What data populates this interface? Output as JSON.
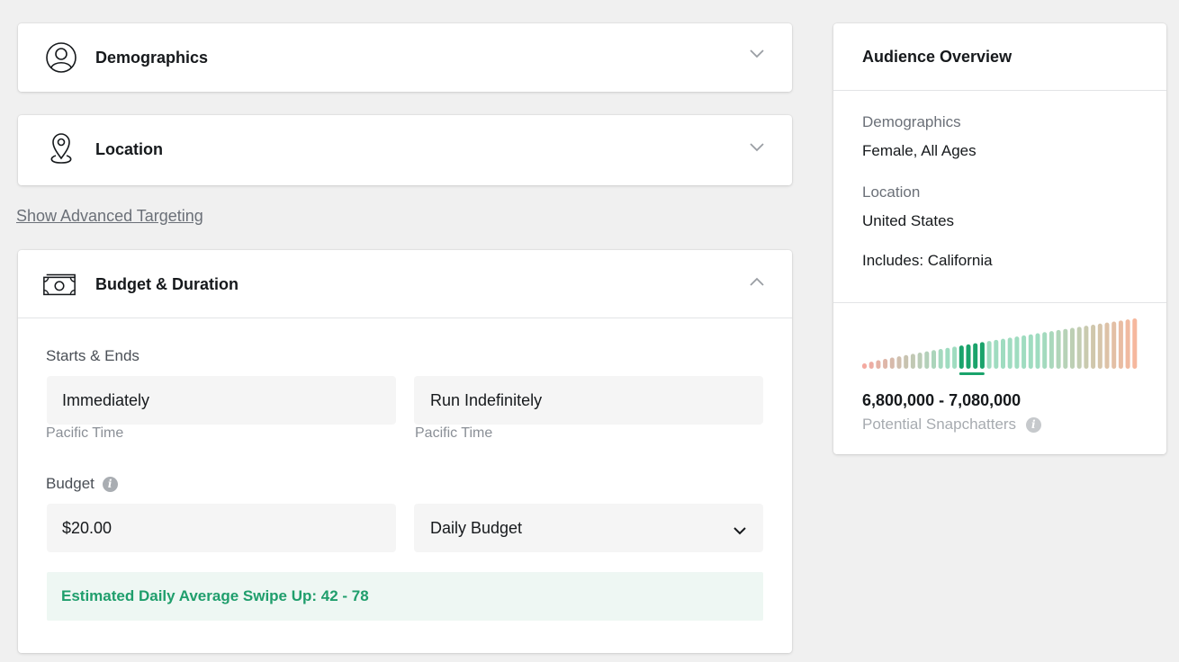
{
  "demographics_section": {
    "title": "Demographics"
  },
  "location_section": {
    "title": "Location"
  },
  "advanced_targeting_link": "Show Advanced Targeting",
  "budget_section": {
    "title": "Budget & Duration",
    "starts_ends_label": "Starts & Ends",
    "start_value": "Immediately",
    "start_timezone": "Pacific Time",
    "end_value": "Run Indefinitely",
    "end_timezone": "Pacific Time",
    "budget_label": "Budget",
    "budget_amount": "$20.00",
    "budget_type": "Daily Budget",
    "estimate_text": "Estimated Daily Average Swipe Up: 42 - 78"
  },
  "audience_overview": {
    "title": "Audience Overview",
    "demographics_label": "Demographics",
    "demographics_value": "Female, All Ages",
    "location_label": "Location",
    "location_value": "United States",
    "includes_value": "Includes: California",
    "reach_range": "6,800,000 - 7,080,000",
    "reach_caption": "Potential Snapchatters",
    "meter_active_bars": [
      14,
      15,
      16,
      17
    ],
    "colors": {
      "low": "#f4a9a0",
      "mid": "#9fdcc0",
      "active": "#1aa36b",
      "high": "#f6b79d"
    }
  },
  "icons": {
    "demographics": "person-circle-icon",
    "location": "map-pin-icon",
    "budget": "banknote-icon",
    "expand": "chevron-down-icon",
    "collapse": "chevron-up-icon",
    "info": "info-icon"
  }
}
